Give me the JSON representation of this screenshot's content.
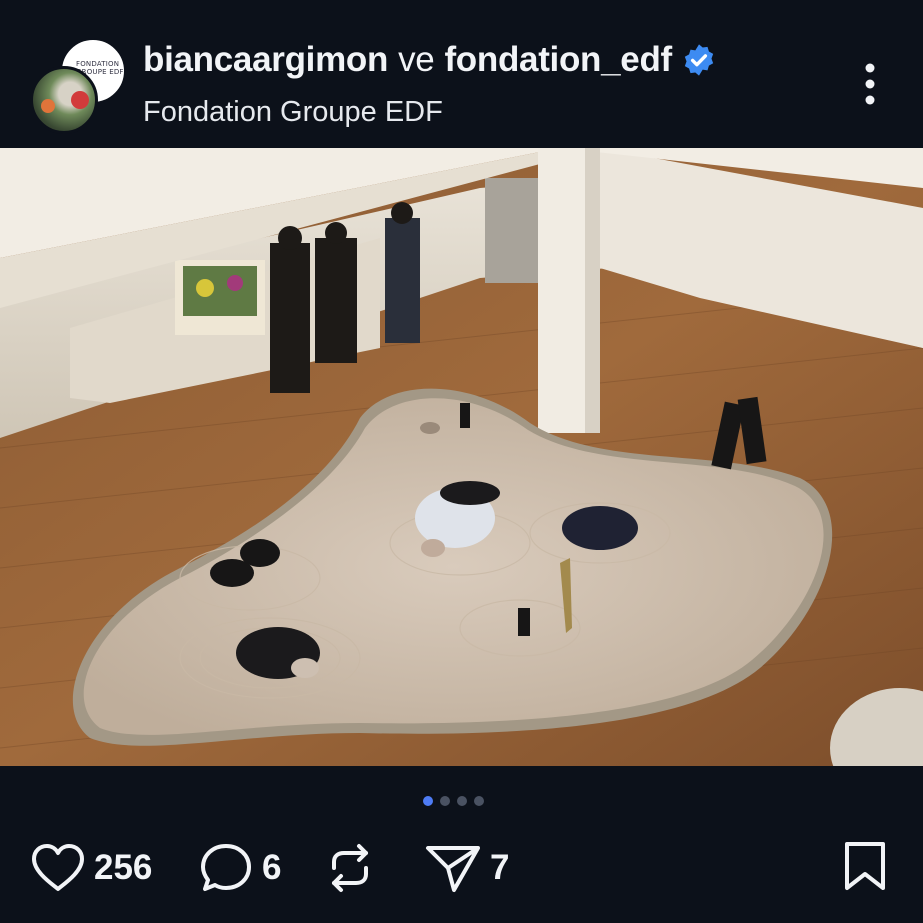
{
  "post": {
    "author_1": "biancaargimon",
    "conjunction": "ve",
    "author_2": "fondation_edf",
    "subtitle": "Fondation Groupe EDF",
    "avatar_logo_text": "FONDATION GROUPE EDF"
  },
  "carousel": {
    "total": 4,
    "active_index": 0
  },
  "actions": {
    "likes": "256",
    "comments": "6",
    "shares": "7"
  },
  "icons": {
    "verified": "verified-badge-icon",
    "more": "more-vertical-icon",
    "like": "heart-icon",
    "comment": "comment-icon",
    "repost": "repost-icon",
    "share": "send-icon",
    "bookmark": "bookmark-icon"
  },
  "colors": {
    "background": "#0c111a",
    "verified": "#3d8bf2",
    "active_dot": "#4e7cf5"
  }
}
